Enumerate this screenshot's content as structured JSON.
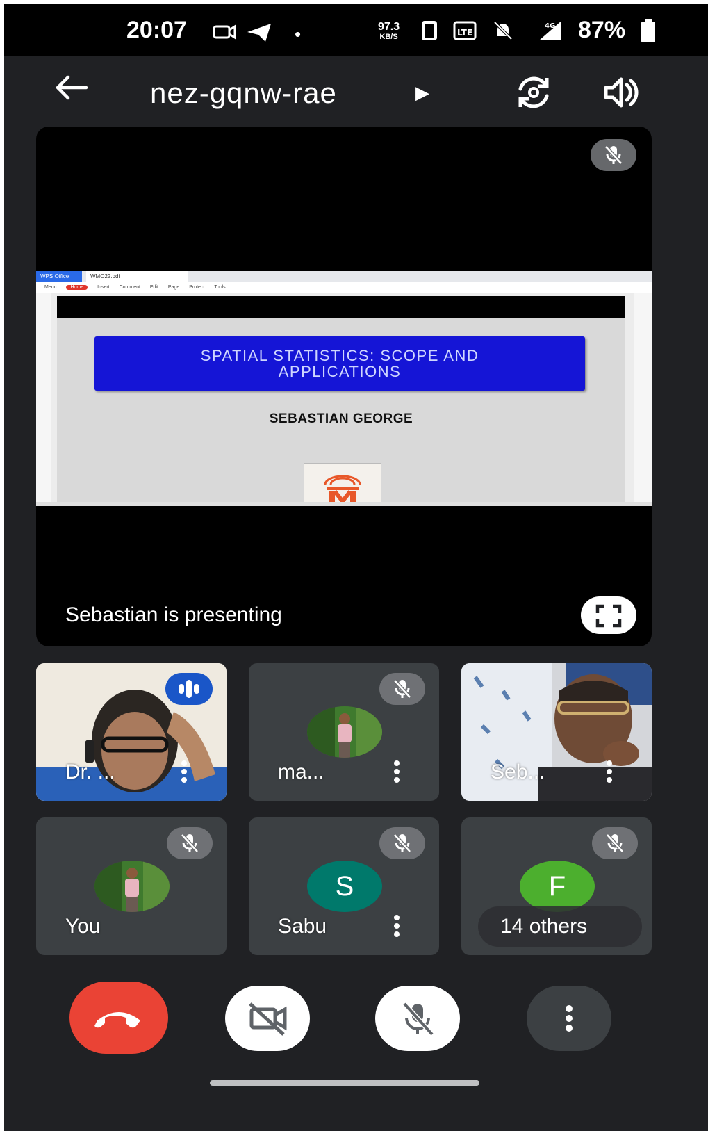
{
  "status_bar": {
    "time": "20:07",
    "net_speed_value": "97.3",
    "net_speed_unit": "KB/S",
    "network": "4G",
    "battery": "87%"
  },
  "top_bar": {
    "meeting_code": "nez-gqnw-rae"
  },
  "presentation": {
    "share_tab_app": "WPS Office",
    "share_tab_file": "WMO22.pdf",
    "toolbar_items": [
      "Menu",
      "Home",
      "Insert",
      "Comment",
      "Edit",
      "Page",
      "Protect",
      "Tools"
    ],
    "slide_title_line1": "SPATIAL STATISTICS: SCOPE AND",
    "slide_title_line2": "APPLICATIONS",
    "slide_author": "SEBASTIAN GEORGE",
    "presenting_text": "Sebastian is presenting"
  },
  "participants": [
    {
      "name": "Dr. ...",
      "state": "speaking"
    },
    {
      "name": "ma...",
      "state": "muted"
    },
    {
      "name": "Seb...",
      "state": "video"
    },
    {
      "name": "You",
      "state": "muted"
    },
    {
      "name": "Sabu",
      "initial": "S",
      "state": "muted"
    },
    {
      "name": "",
      "initial": "F",
      "state": "muted"
    }
  ],
  "others_label": "14 others",
  "colors": {
    "background": "#202124",
    "tile": "#3c4043",
    "end_call": "#ea4335",
    "speaking": "#1a56c8",
    "avatar_s": "#00796b",
    "avatar_f": "#4caf2e",
    "slide_title_box": "#1515d6"
  },
  "controls": [
    "end-call",
    "camera-off",
    "microphone-off",
    "more-options"
  ]
}
